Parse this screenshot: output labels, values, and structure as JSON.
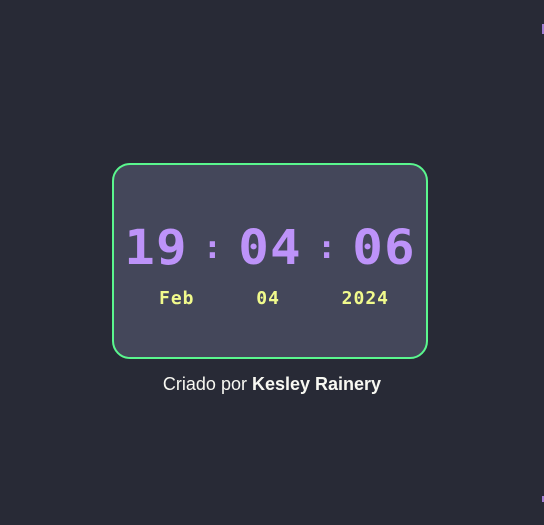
{
  "clock": {
    "hours": "19",
    "separator1": ":",
    "minutes": "04",
    "separator2": ":",
    "seconds": "06"
  },
  "date": {
    "month": "Feb",
    "day": "04",
    "year": "2024"
  },
  "credit": {
    "prefix": "Criado por",
    "author": "Kesley Rainery"
  },
  "colors": {
    "background": "#282a36",
    "card": "#44475a",
    "card_border": "#5af78e",
    "time_text": "#bd93f9",
    "date_text": "#f1fa8c",
    "credit_text": "#f8f8f2"
  }
}
